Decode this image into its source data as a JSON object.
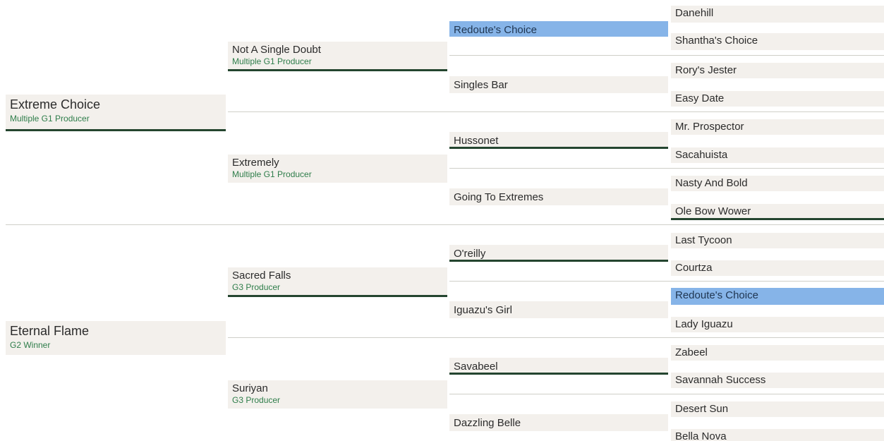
{
  "gen1": [
    {
      "name": "Extreme Choice",
      "note": "Multiple G1 Producer"
    },
    {
      "name": "Eternal Flame",
      "note": "G2 Winner"
    }
  ],
  "gen2": [
    {
      "name": "Not A Single Doubt",
      "note": "Multiple G1 Producer"
    },
    {
      "name": "Extremely",
      "note": "Multiple G1 Producer"
    },
    {
      "name": "Sacred Falls",
      "note": "G3 Producer"
    },
    {
      "name": "Suriyan",
      "note": "G3 Producer"
    }
  ],
  "gen3": [
    {
      "name": "Redoute's Choice"
    },
    {
      "name": "Singles Bar"
    },
    {
      "name": "Hussonet"
    },
    {
      "name": "Going To Extremes"
    },
    {
      "name": "O'reilly"
    },
    {
      "name": "Iguazu's Girl"
    },
    {
      "name": "Savabeel"
    },
    {
      "name": "Dazzling Belle"
    }
  ],
  "gen4": [
    {
      "name": "Danehill"
    },
    {
      "name": "Shantha's Choice"
    },
    {
      "name": "Rory's Jester"
    },
    {
      "name": "Easy Date"
    },
    {
      "name": "Mr. Prospector"
    },
    {
      "name": "Sacahuista"
    },
    {
      "name": "Nasty And Bold"
    },
    {
      "name": "Ole Bow Wower"
    },
    {
      "name": "Last Tycoon"
    },
    {
      "name": "Courtza"
    },
    {
      "name": "Redoute's Choice"
    },
    {
      "name": "Lady Iguazu"
    },
    {
      "name": "Zabeel"
    },
    {
      "name": "Savannah Success"
    },
    {
      "name": "Desert Sun"
    },
    {
      "name": "Bella Nova"
    }
  ],
  "colors": {
    "box_background": "#f3f0ec",
    "highlight": "#86b4e8",
    "underline": "#24452f",
    "note_text": "#2e7d4a",
    "divider": "#cfcfc8"
  }
}
